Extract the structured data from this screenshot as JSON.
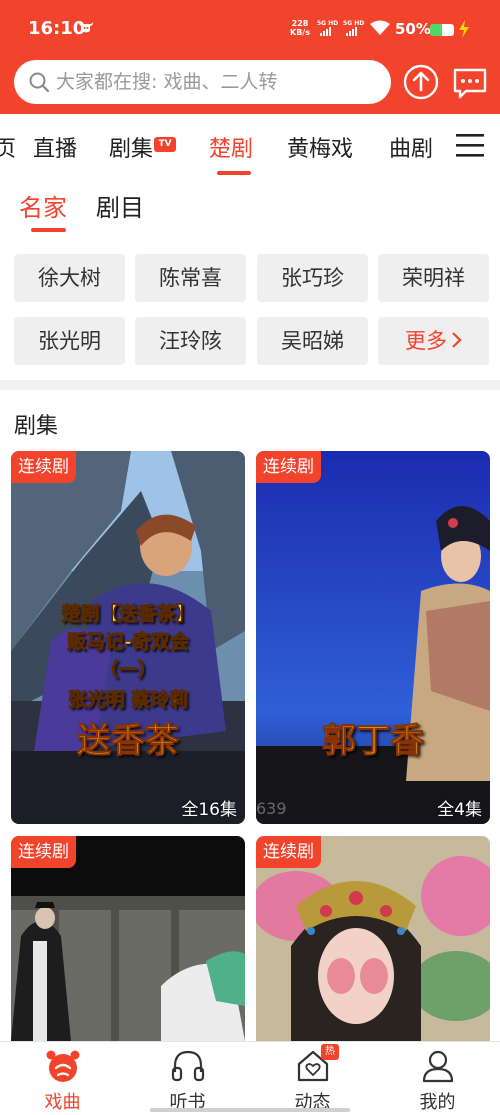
{
  "status_bar": {
    "time": "16:10",
    "speed_value": "228",
    "speed_unit": "KB/s",
    "net1": "5G HD",
    "net2": "5G HD",
    "battery": "50%",
    "battery_level": 0.5
  },
  "search": {
    "placeholder": "大家都在搜: 戏曲、二人转"
  },
  "tabs": [
    {
      "label": "页"
    },
    {
      "label": "直播"
    },
    {
      "label": "剧集",
      "badge": "TV"
    },
    {
      "label": "楚剧",
      "active": true
    },
    {
      "label": "黄梅戏"
    },
    {
      "label": "曲剧"
    }
  ],
  "subtabs": [
    {
      "label": "名家",
      "active": true
    },
    {
      "label": "剧目"
    }
  ],
  "artists": [
    "徐大树",
    "陈常喜",
    "张巧珍",
    "荣明祥",
    "张光明",
    "汪玲陔",
    "吴昭娣"
  ],
  "more_label": "更多",
  "section_title": "剧集",
  "cards": [
    {
      "badge": "连续剧",
      "episodes": "全16集",
      "caption_lines": [
        "楚剧【送香茶】",
        "贩马记-奇双会",
        "（一）",
        "张光明 蔡玲莉",
        "送香茶"
      ]
    },
    {
      "badge": "连续剧",
      "episodes": "全4集",
      "caption_lines": [
        "郭丁香"
      ],
      "watermark": "639"
    },
    {
      "badge": "连续剧"
    },
    {
      "badge": "连续剧"
    }
  ],
  "bottom_nav": [
    {
      "label": "戏曲",
      "icon": "opera-mask-icon",
      "active": true
    },
    {
      "label": "听书",
      "icon": "headphones-icon"
    },
    {
      "label": "动态",
      "icon": "home-heart-icon",
      "badge": "热"
    },
    {
      "label": "我的",
      "icon": "user-icon"
    }
  ],
  "colors": {
    "accent": "#f2432c",
    "chip_bg": "#efefef"
  }
}
